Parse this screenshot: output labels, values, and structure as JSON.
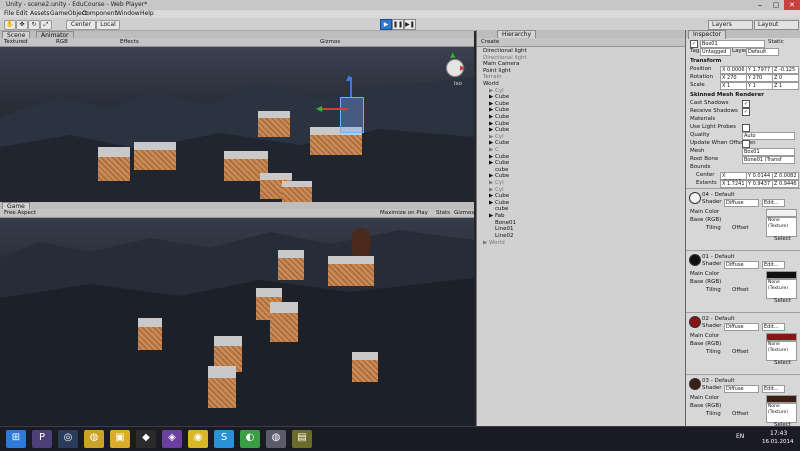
{
  "window": {
    "title": "Unity - scene2.unity - EduCourse - Web Player*"
  },
  "menu": [
    "File",
    "Edit",
    "Assets",
    "GameObject",
    "Component",
    "Window",
    "Help"
  ],
  "toolbar": {
    "center_label": "Center",
    "local_label": "Local",
    "layers_label": "Layers",
    "layout_label": "Layout"
  },
  "scene": {
    "tab_scene": "Scene",
    "tab_animator": "Animator",
    "shading_mode": "Textured",
    "render_mode": "RGB",
    "effects_label": "Effects",
    "gizmos_label": "Gizmos",
    "gizmo_label": "Iso"
  },
  "game": {
    "tab_game": "Game",
    "aspect": "Free Aspect",
    "maximize": "Maximize on Play",
    "stats": "Stats",
    "gizmos": "Gizmos"
  },
  "hierarchy": {
    "header_left": "Create",
    "header_tab": "Hierarchy",
    "items": [
      {
        "label": "Directional light",
        "indent": 0,
        "faded": false
      },
      {
        "label": "Directional light",
        "indent": 0,
        "faded": true
      },
      {
        "label": "Main Camera",
        "indent": 0,
        "faded": false
      },
      {
        "label": "Point light",
        "indent": 0,
        "faded": false
      },
      {
        "label": "Terrain",
        "indent": 0,
        "faded": true
      },
      {
        "label": "World",
        "indent": 0,
        "faded": false
      },
      {
        "label": "▶ Cyl",
        "indent": 1,
        "faded": true
      },
      {
        "label": "▶ Cube",
        "indent": 1,
        "faded": false
      },
      {
        "label": "▶ Cube",
        "indent": 1,
        "faded": false
      },
      {
        "label": "▶ Cube",
        "indent": 1,
        "faded": false
      },
      {
        "label": "▶ Cube",
        "indent": 1,
        "faded": false
      },
      {
        "label": "▶ Cube",
        "indent": 1,
        "faded": false
      },
      {
        "label": "▶ Cube",
        "indent": 1,
        "faded": false
      },
      {
        "label": "▶ Cyl",
        "indent": 1,
        "faded": true
      },
      {
        "label": "▶ Cube",
        "indent": 1,
        "faded": false
      },
      {
        "label": "▶ C",
        "indent": 1,
        "faded": true
      },
      {
        "label": "▶ Cube",
        "indent": 1,
        "faded": false
      },
      {
        "label": "▶ Cube",
        "indent": 1,
        "faded": false
      },
      {
        "label": "cube",
        "indent": 2,
        "faded": false
      },
      {
        "label": "▶ Cube",
        "indent": 1,
        "faded": false
      },
      {
        "label": "▶ Cyl",
        "indent": 1,
        "faded": true
      },
      {
        "label": "▶ Cyl",
        "indent": 1,
        "faded": true
      },
      {
        "label": "▶ Cube",
        "indent": 1,
        "faded": false
      },
      {
        "label": "▶ Cube",
        "indent": 1,
        "faded": false
      },
      {
        "label": "cube",
        "indent": 2,
        "faded": false
      },
      {
        "label": "▶ Fab",
        "indent": 1,
        "faded": false
      },
      {
        "label": "Bone01",
        "indent": 2,
        "faded": false
      }
    ],
    "lower_items": [
      {
        "label": "Line01",
        "indent": 2,
        "faded": false
      },
      {
        "label": "Line02",
        "indent": 2,
        "faded": false
      },
      {
        "label": "▶ World",
        "indent": 0,
        "faded": true
      }
    ]
  },
  "inspector": {
    "header": "Inspector",
    "object_name": "Box01",
    "static_label": "Static",
    "tag_label": "Tag",
    "tag_value": "Untagged",
    "layer_label": "Layer",
    "layer_value": "Default",
    "transform_title": "Transform",
    "position_label": "Position",
    "position": [
      "X 0.0006",
      "Y 1.7977",
      "Z -0.125"
    ],
    "rotation_label": "Rotation",
    "rotation": [
      "X 270",
      "Y 270",
      "Z 0"
    ],
    "scale_label": "Scale",
    "scale": [
      "X 1",
      "Y 1",
      "Z 1"
    ],
    "smr_title": "Skinned Mesh Renderer",
    "cast_shadows": "Cast Shadows",
    "receive_shadows": "Receive Shadows",
    "materials": "Materials",
    "use_light_probes": "Use Light Probes",
    "quality": "Quality",
    "quality_value": "Auto",
    "update_offscreen": "Update When Offscreen",
    "mesh": "Mesh",
    "mesh_value": "Box01",
    "root_bone": "Root Bone",
    "root_bone_value": "Bone01 (Transf",
    "bounds": "Bounds",
    "center": "Center",
    "center_vals": [
      "X -0.5113",
      "Y 0.0144",
      "Z 0.0082"
    ],
    "extents": "Extents",
    "extents_vals": [
      "X 1.7241",
      "Y 0.9437",
      "Z 0.9446"
    ],
    "materials_list": [
      {
        "name": "04 - Default",
        "color": "#f2f2f2",
        "shader": "Diffuse",
        "main_color": "Main Color",
        "base": "Base (RGB)",
        "tiling": "Tiling",
        "offset": "Offset",
        "none": "None (Texture)",
        "select": "Select"
      },
      {
        "name": "01 - Default",
        "color": "#101010",
        "shader": "Diffuse",
        "main_color": "Main Color",
        "base": "Base (RGB)",
        "tiling": "Tiling",
        "offset": "Offset",
        "none": "None (Texture)",
        "select": "Select"
      },
      {
        "name": "02 - Default",
        "color": "#8a1414",
        "shader": "Diffuse",
        "main_color": "Main Color",
        "base": "Base (RGB)",
        "tiling": "Tiling",
        "offset": "Offset",
        "none": "None (Texture)",
        "select": "Select"
      },
      {
        "name": "03 - Default",
        "color": "#3a2014",
        "shader": "Diffuse",
        "main_color": "Main Color",
        "base": "Base (RGB)",
        "tiling": "Tiling",
        "offset": "Offset",
        "none": "None (Texture)",
        "select": "Select"
      }
    ],
    "shader_label": "Shader",
    "edit_label": "Edit..."
  },
  "taskbar": {
    "apps": [
      "start-button",
      "app-p",
      "app-1",
      "app-2",
      "app-3",
      "app-unity",
      "app-vs",
      "app-chrome",
      "app-skype",
      "app-5",
      "app-6",
      "app-7"
    ],
    "lang": "EN",
    "time": "17:43",
    "date": "16.01.2014"
  }
}
